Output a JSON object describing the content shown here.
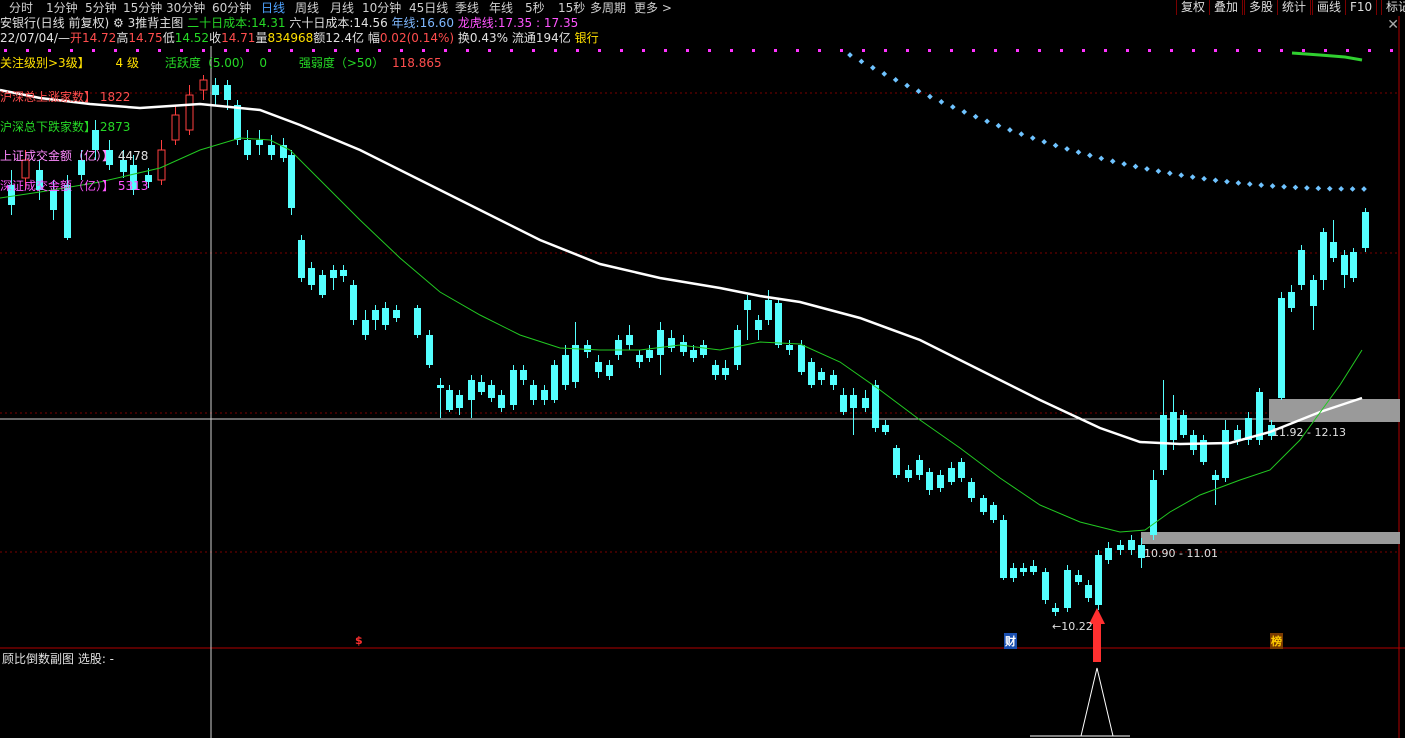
{
  "toolbar": {
    "periods": [
      "分时",
      "1分钟",
      "5分钟",
      "15分钟",
      "30分钟",
      "60分钟",
      "日线",
      "周线",
      "月线",
      "10分钟",
      "45日线",
      "季线",
      "年线",
      "5秒",
      "15秒",
      "多周期",
      "更多 >"
    ],
    "active_period": "日线",
    "right_buttons": [
      "复权",
      "叠加",
      "多股",
      "统计",
      "画线",
      "F10",
      "标记"
    ]
  },
  "info": {
    "stock_title": "安银行(日线 前复权)",
    "template_icon": "gear-icon",
    "template_name": "3推背主图",
    "cost20_label": "二十日成本:",
    "cost20_value": "14.31",
    "cost60_label": "六十日成本:",
    "cost60_value": "14.56",
    "year_label": "年线:",
    "year_value": "16.60",
    "dragon_label": "龙虎线:",
    "dragon_value": "17.35",
    "dragon_value2": ": 17.35",
    "date": "22/07/04/—",
    "open_label": "开",
    "open_value": "14.72",
    "high_label": "高",
    "high_value": "14.75",
    "low_label": "低",
    "low_value": "14.52",
    "close_label": "收",
    "close_value": "14.71",
    "vol_label": "量",
    "vol_value": "834968",
    "amt_label": "额",
    "amt_value": "12.4亿",
    "chg_label": "幅",
    "chg_value": "0.02(0.14%)",
    "turn_label": "换",
    "turn_value": "0.43%",
    "float_label": "流通",
    "float_value": "194亿",
    "sector": "银行"
  },
  "indicators": {
    "focus_label": "关注级别>3级】",
    "focus_value": "4 级",
    "active_label": "活跃度（5.00）",
    "active_value": "0",
    "strength_label": "强弱度（>50）",
    "strength_value": "118.865",
    "up_label": "沪深总上涨家数】",
    "up_value": "1822",
    "down_label": "沪深总下跌家数】",
    "down_value": "2873",
    "sh_label": "上证成交金额（亿）】",
    "sh_value": "4478",
    "sz_label": "深证成交金额（亿）】",
    "sz_value": "5313"
  },
  "price_labels": {
    "zone_high": "11.92 - 12.13",
    "zone_low": "10.90 - 11.01",
    "min_price": "←10.22"
  },
  "marks": {
    "dollar": "$",
    "finance": "财",
    "list": "榜"
  },
  "sub_chart": {
    "title": "顾比倒数副图 选股: -"
  },
  "colors": {
    "up": "#ff4040",
    "down": "#54ffff",
    "ma_long": "#ffffff",
    "ma_short": "#22c922",
    "dots": "#6fc3ff",
    "zone": "#9a9a9a",
    "grid": "#7a0000",
    "arrow": "#ff3030"
  }
}
